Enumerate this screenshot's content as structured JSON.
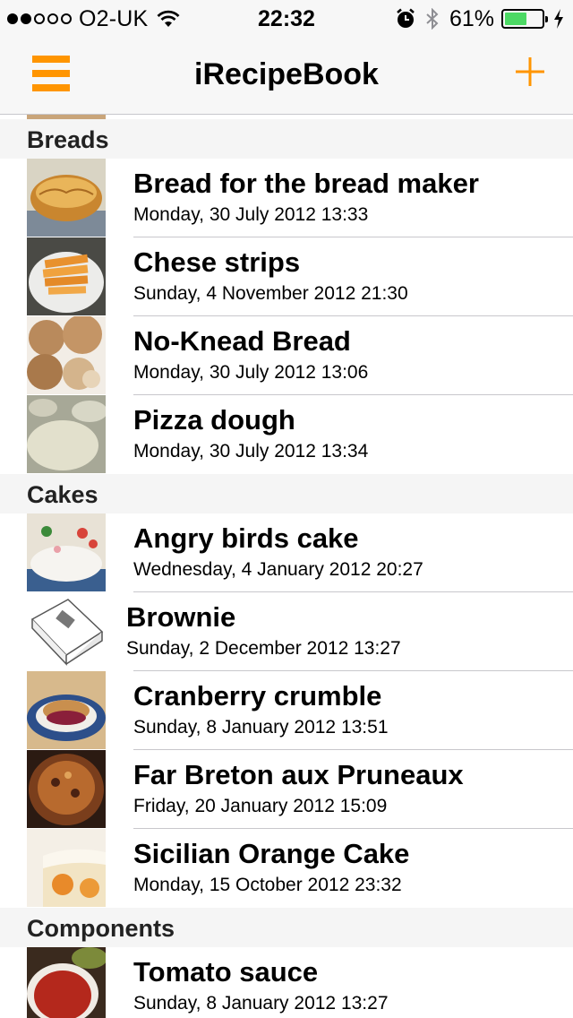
{
  "status_bar": {
    "carrier": "O2-UK",
    "time": "22:32",
    "battery_percent": "61%",
    "battery_level": 0.61,
    "signal_bars": 2,
    "icons": [
      "wifi-icon",
      "alarm-icon",
      "bluetooth-icon",
      "charging-bolt-icon"
    ]
  },
  "nav": {
    "title": "iRecipeBook",
    "menu_icon": "hamburger-menu-icon",
    "add_icon": "plus-icon",
    "accent_color": "#ff9500"
  },
  "sections": [
    {
      "title": "Breads",
      "rows": [
        {
          "title": "Bread for the bread maker",
          "date": "Monday, 30 July 2012 13:33"
        },
        {
          "title": "Chese strips",
          "date": "Sunday, 4 November 2012 21:30"
        },
        {
          "title": "No-Knead Bread",
          "date": "Monday, 30 July 2012 13:06"
        },
        {
          "title": "Pizza dough",
          "date": "Monday, 30 July 2012 13:34"
        }
      ]
    },
    {
      "title": "Cakes",
      "rows": [
        {
          "title": "Angry birds cake",
          "date": "Wednesday, 4 January 2012 20:27"
        },
        {
          "title": "Brownie",
          "date": "Sunday, 2 December 2012 13:27"
        },
        {
          "title": "Cranberry crumble",
          "date": "Sunday, 8 January 2012 13:51"
        },
        {
          "title": "Far Breton aux Pruneaux",
          "date": "Friday, 20 January 2012 15:09"
        },
        {
          "title": "Sicilian Orange Cake",
          "date": "Monday, 15 October 2012 23:32"
        }
      ]
    },
    {
      "title": "Components",
      "rows": [
        {
          "title": "Tomato sauce",
          "date": "Sunday, 8 January 2012 13:27"
        }
      ]
    }
  ]
}
